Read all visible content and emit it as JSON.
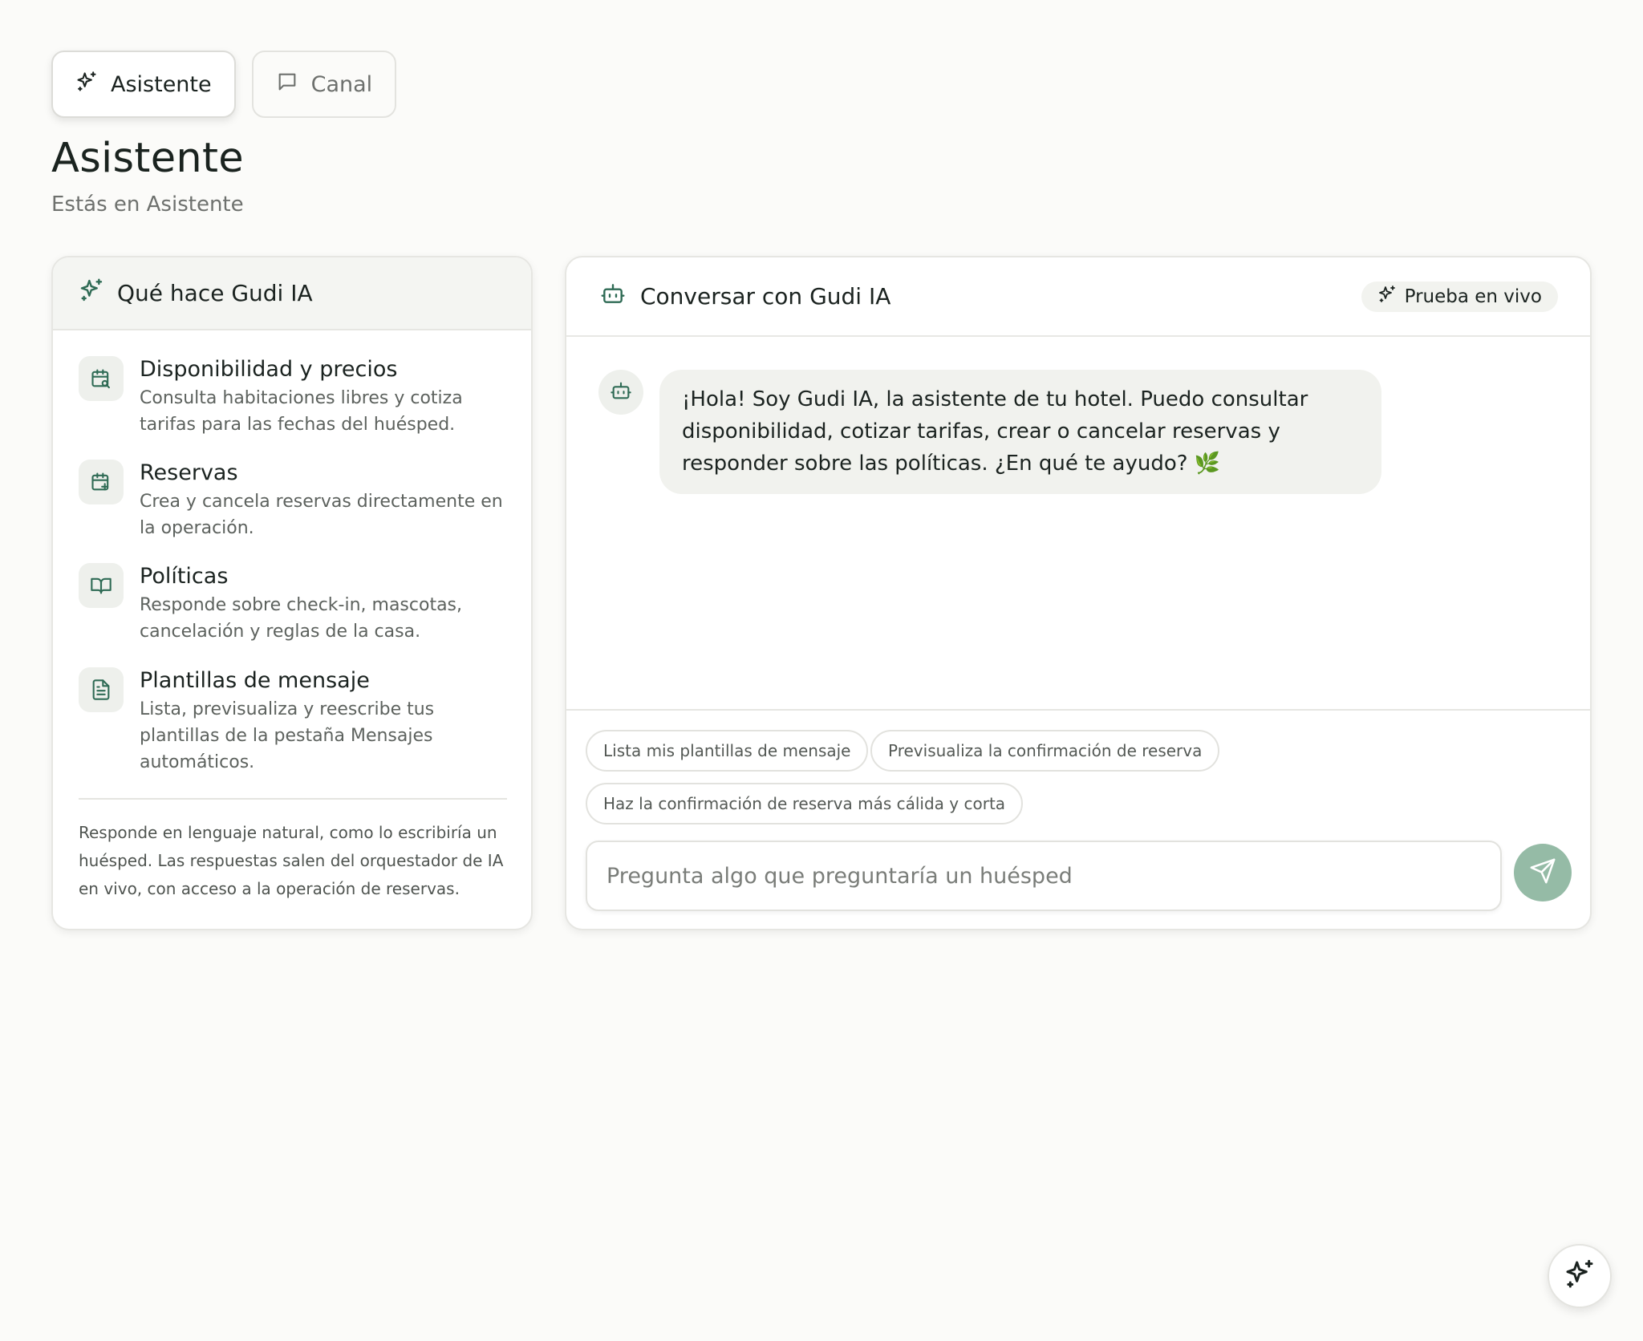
{
  "tabs": [
    {
      "label": "Asistente",
      "icon": "sparkles-icon",
      "active": true
    },
    {
      "label": "Canal",
      "icon": "message-square-icon",
      "active": false
    }
  ],
  "page": {
    "title": "Asistente",
    "subtitle": "Estás en Asistente"
  },
  "capabilities": {
    "title": "Qué hace Gudi IA",
    "items": [
      {
        "icon": "calendar-search-icon",
        "title": "Disponibilidad y precios",
        "description": "Consulta habitaciones libres y cotiza tarifas para las fechas del huésped."
      },
      {
        "icon": "calendar-plus-icon",
        "title": "Reservas",
        "description": "Crea y cancela reservas directamente en la operación."
      },
      {
        "icon": "book-open-icon",
        "title": "Políticas",
        "description": "Responde sobre check-in, mascotas, cancelación y reglas de la casa."
      },
      {
        "icon": "file-text-icon",
        "title": "Plantillas de mensaje",
        "description": "Lista, previsualiza y reescribe tus plantillas de la pestaña Mensajes automáticos."
      }
    ],
    "note": "Responde en lenguaje natural, como lo escribiría un huésped. Las respuestas salen del orquestador de IA en vivo, con acceso a la operación de reservas."
  },
  "chat": {
    "title": "Conversar con Gudi IA",
    "badge": "Prueba en vivo",
    "messages": [
      {
        "role": "assistant",
        "text": "¡Hola! Soy Gudi IA, la asistente de tu hotel. Puedo consultar disponibilidad, cotizar tarifas, crear o cancelar reservas y responder sobre las políticas. ¿En qué te ayudo? 🌿"
      }
    ],
    "suggestions": [
      "Lista mis plantillas de mensaje",
      "Previsualiza la confirmación de reserva",
      "Haz la confirmación de reserva más cálida y corta"
    ],
    "input_placeholder": "Pregunta algo que preguntaría un huésped",
    "input_value": ""
  },
  "colors": {
    "accent": "#2f6b55",
    "send_button": "#95bba6",
    "background": "#fbfbf9"
  }
}
